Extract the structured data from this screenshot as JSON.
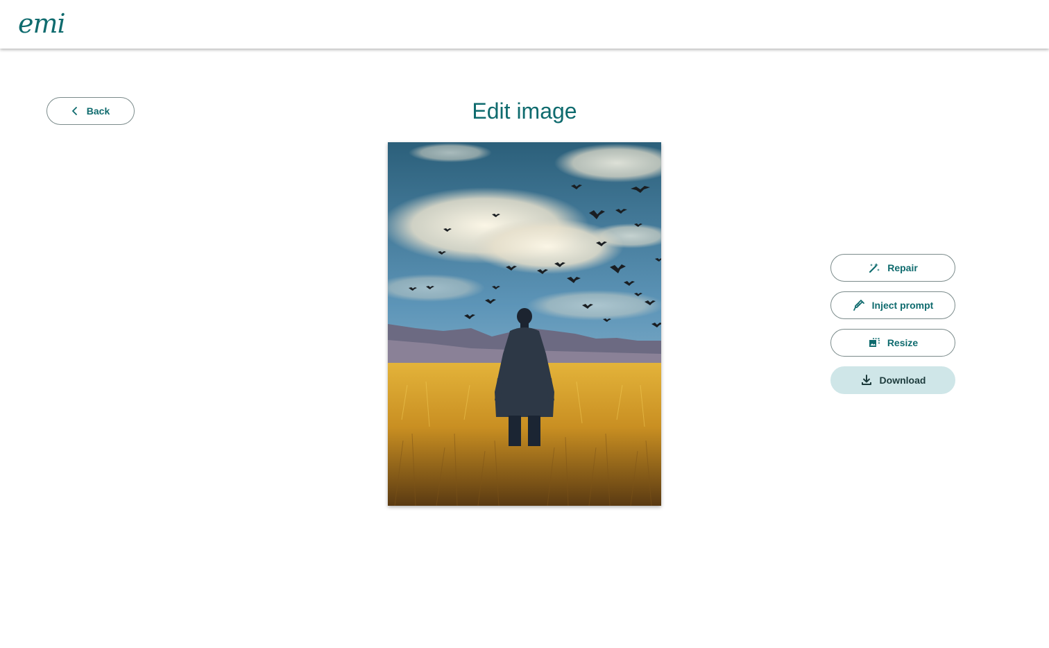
{
  "brand": {
    "logo_text": "emi",
    "accent_color": "#0f6b6e"
  },
  "navigation": {
    "back_label": "Back",
    "back_icon": "chevron-left-icon"
  },
  "page": {
    "title": "Edit image"
  },
  "image": {
    "description_alt": "Edited image preview"
  },
  "actions": [
    {
      "label": "Repair",
      "icon": "magic-wand-icon",
      "style": "outlined"
    },
    {
      "label": "Inject prompt",
      "icon": "syringe-icon",
      "style": "outlined"
    },
    {
      "label": "Resize",
      "icon": "resize-image-icon",
      "style": "outlined"
    },
    {
      "label": "Download",
      "icon": "download-icon",
      "style": "filled",
      "fill_color": "#cfe6e8"
    }
  ]
}
